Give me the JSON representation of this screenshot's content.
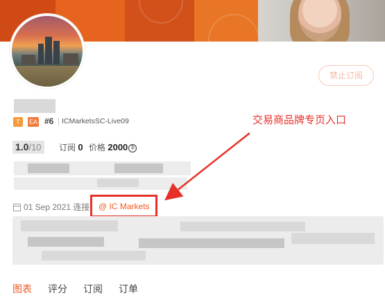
{
  "profile": {
    "unsubscribe_label": "禁止订阅",
    "badges": [
      {
        "label": "T",
        "color": "#f59a3a"
      },
      {
        "label": "EA",
        "color": "#f07a3a"
      }
    ],
    "rank": "#6",
    "account": "ICMarketsSC-Live09",
    "score": "1.0",
    "score_max": "/10",
    "subscribers_label": "订阅",
    "subscribers_value": "0",
    "price_label": "价格",
    "price_value": "2000",
    "date": "01 Sep 2021 连接",
    "broker_link": "@ IC Markets"
  },
  "annotation": {
    "text": "交易商品牌专页入口",
    "color": "#e8302a"
  },
  "tabs": [
    {
      "label": "图表",
      "active": true
    },
    {
      "label": "评分",
      "active": false
    },
    {
      "label": "订阅",
      "active": false
    },
    {
      "label": "订单",
      "active": false
    }
  ],
  "colors": {
    "accent": "#ee5a24",
    "banner": "#e25a17"
  }
}
